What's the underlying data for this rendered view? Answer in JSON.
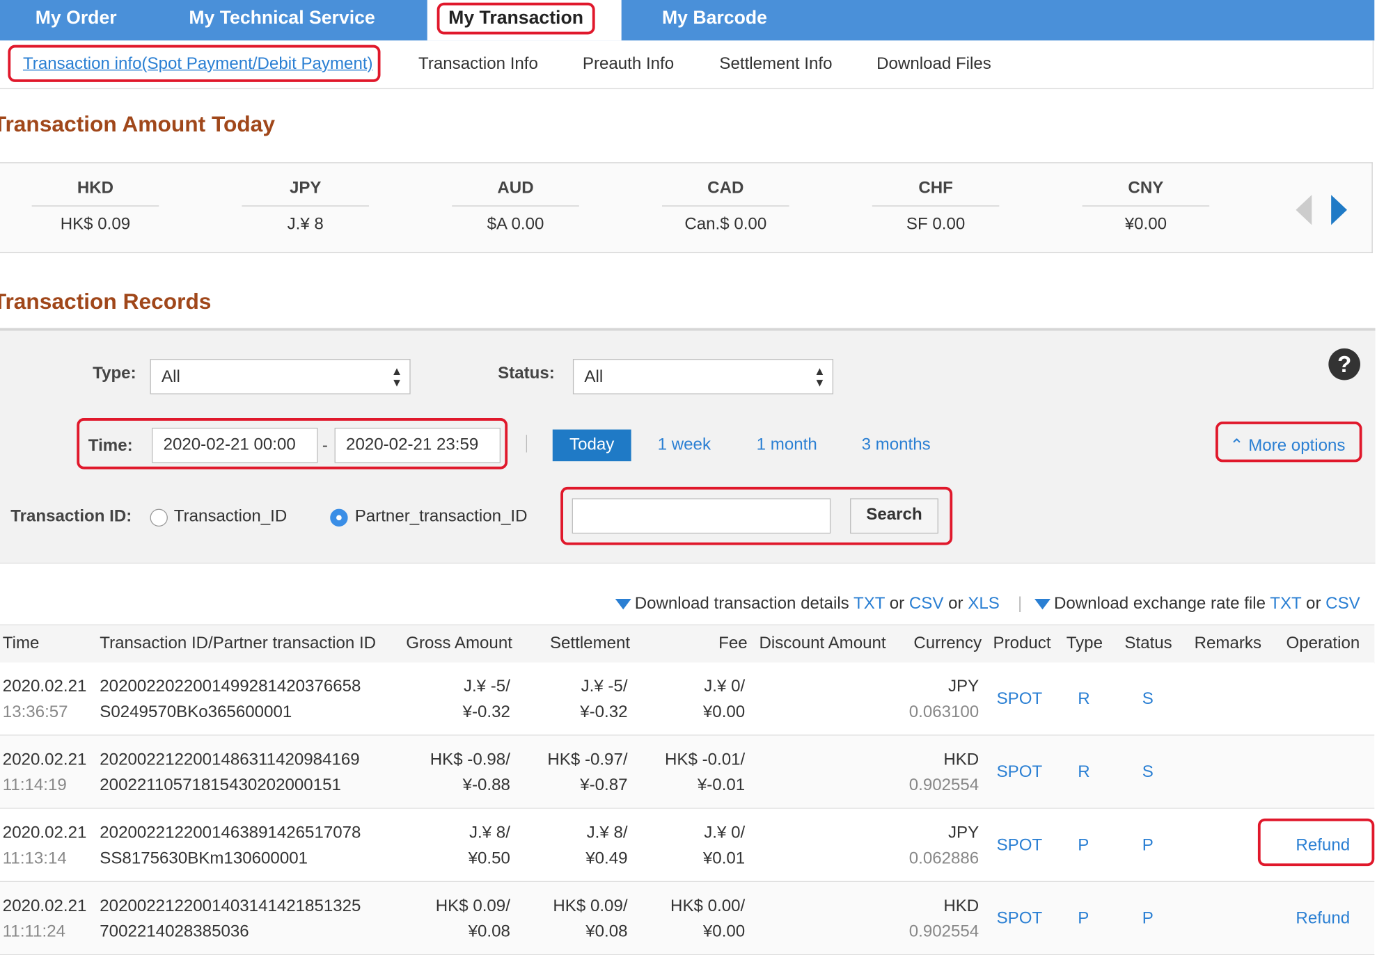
{
  "top_nav": {
    "tabs": [
      "My Order",
      "My Technical Service",
      "My Transaction",
      "My Barcode"
    ]
  },
  "sub_nav": {
    "items": [
      "Transaction info(Spot Payment/Debit Payment)",
      "Transaction Info",
      "Preauth Info",
      "Settlement Info",
      "Download Files"
    ]
  },
  "amount_today": {
    "title": "Transaction Amount Today",
    "currencies": [
      {
        "code": "HKD",
        "value": "HK$ 0.09"
      },
      {
        "code": "JPY",
        "value": "J.¥ 8"
      },
      {
        "code": "AUD",
        "value": "$A 0.00"
      },
      {
        "code": "CAD",
        "value": "Can.$ 0.00"
      },
      {
        "code": "CHF",
        "value": "SF 0.00"
      },
      {
        "code": "CNY",
        "value": "¥0.00"
      }
    ]
  },
  "records": {
    "title": "Transaction Records",
    "type_label": "Type:",
    "type_value": "All",
    "status_label": "Status:",
    "status_value": "All",
    "time_label": "Time:",
    "time_from": "2020-02-21 00:00",
    "time_sep": "-",
    "time_to": "2020-02-21 23:59",
    "quick": [
      "Today",
      "1 week",
      "1 month",
      "3 months"
    ],
    "more_options": "More options",
    "txid_label": "Transaction ID:",
    "radio_options": [
      "Transaction_ID",
      "Partner_transaction_ID"
    ],
    "search_button": "Search",
    "help": "?"
  },
  "downloads": {
    "details_prefix": "Download transaction details",
    "details_links": [
      "TXT",
      "CSV",
      "XLS"
    ],
    "or": "or",
    "sep": "|",
    "rate_prefix": "Download exchange rate file",
    "rate_links": [
      "TXT",
      "CSV"
    ]
  },
  "table": {
    "headers": [
      "Time",
      "Transaction ID/Partner transaction ID",
      "Gross Amount",
      "Settlement",
      "Fee",
      "Discount Amount",
      "Currency",
      "Product",
      "Type",
      "Status",
      "Remarks",
      "Operation"
    ],
    "rows": [
      {
        "date": "2020.02.21",
        "time": "13:36:57",
        "tx_id": "2020022022001499281420376658",
        "partner_id": "S0249570BKo365600001",
        "gross1": "J.¥ -5/",
        "gross2": "¥-0.32",
        "settle1": "J.¥ -5/",
        "settle2": "¥-0.32",
        "fee1": "J.¥ 0/",
        "fee2": "¥0.00",
        "currency": "JPY",
        "rate": "0.063100",
        "product": "SPOT",
        "type": "R",
        "status": "S",
        "operation": ""
      },
      {
        "date": "2020.02.21",
        "time": "11:14:19",
        "tx_id": "2020022122001486311420984169",
        "partner_id": "2002211057181543020200015​1",
        "gross1": "HK$ -0.98/",
        "gross2": "¥-0.88",
        "settle1": "HK$ -0.97/",
        "settle2": "¥-0.87",
        "fee1": "HK$ -0.01/",
        "fee2": "¥-0.01",
        "currency": "HKD",
        "rate": "0.902554",
        "product": "SPOT",
        "type": "R",
        "status": "S",
        "operation": ""
      },
      {
        "date": "2020.02.21",
        "time": "11:13:14",
        "tx_id": "2020022122001463891426517078",
        "partner_id": "SS8175630BKm130600001",
        "gross1": "J.¥ 8/",
        "gross2": "¥0.50",
        "settle1": "J.¥ 8/",
        "settle2": "¥0.49",
        "fee1": "J.¥ 0/",
        "fee2": "¥0.01",
        "currency": "JPY",
        "rate": "0.062886",
        "product": "SPOT",
        "type": "P",
        "status": "P",
        "operation": "Refund"
      },
      {
        "date": "2020.02.21",
        "time": "11:11:24",
        "tx_id": "2020022122001403141421851325",
        "partner_id": "7002214028385036",
        "gross1": "HK$ 0.09/",
        "gross2": "¥0.08",
        "settle1": "HK$ 0.09/",
        "settle2": "¥0.08",
        "fee1": "HK$ 0.00/",
        "fee2": "¥0.00",
        "currency": "HKD",
        "rate": "0.902554",
        "product": "SPOT",
        "type": "P",
        "status": "P",
        "operation": "Refund"
      }
    ]
  },
  "colors": {
    "nav_bg": "#4a90d9",
    "accent": "#2a7fd3",
    "title": "#a0471a",
    "highlight": "#e0182b"
  }
}
